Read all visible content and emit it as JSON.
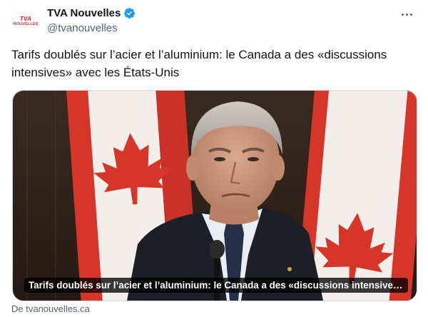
{
  "account": {
    "display_name": "TVA Nouvelles",
    "handle": "@tvanouvelles",
    "avatar_logo_top": "TVA",
    "avatar_logo_bottom": "NOUVELLES",
    "verified_color": "#1d9bf0"
  },
  "tweet": {
    "text": "Tarifs doublés sur l’acier et l’aluminium: le Canada a des «discussions intensives» avec les États-Unis"
  },
  "card": {
    "caption": "Tarifs doublés sur l’acier et l’aluminium: le Canada a des «discussions intensives» ave…",
    "source": "De tvanouvelles.ca"
  },
  "icons": {
    "more": "more-horizontal-icon",
    "verified": "verified-badge-icon"
  },
  "colors": {
    "text": "#0f1419",
    "secondary": "#536471",
    "flag_red": "#d6362a"
  }
}
